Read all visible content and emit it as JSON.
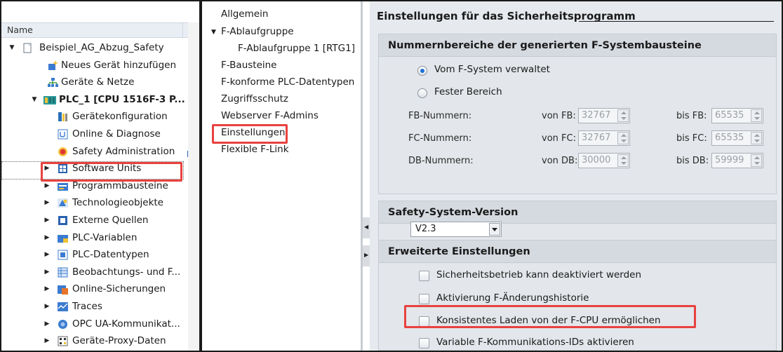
{
  "tree": {
    "header": "Name",
    "rows": [
      {
        "label": "Beispiel_AG_Abzug_Safety",
        "icon": "project-icon",
        "arrow": "open"
      },
      {
        "label": "Neues Gerät hinzufügen",
        "icon": "add-device-icon",
        "arrow": ""
      },
      {
        "label": "Geräte & Netze",
        "icon": "devices-networks-icon",
        "arrow": ""
      },
      {
        "label": "PLC_1 [CPU 1516F-3 P...",
        "icon": "plc-icon",
        "arrow": "open"
      },
      {
        "label": "Gerätekonfiguration",
        "icon": "device-config-icon",
        "arrow": ""
      },
      {
        "label": "Online & Diagnose",
        "icon": "online-diagnostics-icon",
        "arrow": ""
      },
      {
        "label": "Safety Administration",
        "icon": "safety-admin-icon",
        "arrow": ""
      },
      {
        "label": "Software Units",
        "icon": "software-units-icon",
        "arrow": "closed"
      },
      {
        "label": "Programmbausteine",
        "icon": "program-blocks-icon",
        "arrow": "closed"
      },
      {
        "label": "Technologieobjekte",
        "icon": "technology-objects-icon",
        "arrow": "closed"
      },
      {
        "label": "Externe Quellen",
        "icon": "external-sources-icon",
        "arrow": "closed"
      },
      {
        "label": "PLC-Variablen",
        "icon": "plc-tags-icon",
        "arrow": "closed"
      },
      {
        "label": "PLC-Datentypen",
        "icon": "plc-datatypes-icon",
        "arrow": "closed"
      },
      {
        "label": "Beobachtungs- und F...",
        "icon": "watch-tables-icon",
        "arrow": "closed"
      },
      {
        "label": "Online-Sicherungen",
        "icon": "online-backups-icon",
        "arrow": "closed"
      },
      {
        "label": "Traces",
        "icon": "traces-icon",
        "arrow": "closed"
      },
      {
        "label": "OPC UA-Kommunikat...",
        "icon": "opcua-icon",
        "arrow": "closed"
      },
      {
        "label": "Geräte-Proxy-Daten",
        "icon": "device-proxy-icon",
        "arrow": "closed"
      }
    ]
  },
  "nav": {
    "items": [
      {
        "label": "Allgemein"
      },
      {
        "label": "F-Ablaufgruppe"
      },
      {
        "label": "F-Ablaufgruppe 1 [RTG1]"
      },
      {
        "label": "F-Bausteine"
      },
      {
        "label": "F-konforme PLC-Datentypen"
      },
      {
        "label": "Zugriffsschutz"
      },
      {
        "label": "Webserver F-Admins"
      },
      {
        "label": "Einstellungen"
      },
      {
        "label": "Flexible F-Link"
      }
    ]
  },
  "panel": {
    "title": "Einstellungen für das Sicherheitsprogramm",
    "numbers": {
      "title": "Nummernbereiche der generierten F-Systembausteine",
      "radio_managed": "Vom F-System verwaltet",
      "radio_fixed": "Fester Bereich",
      "selected": "managed",
      "rows": [
        {
          "label": "FB-Nummern:",
          "from_label": "von FB:",
          "from_value": "32767",
          "to_label": "bis FB:",
          "to_value": "65535"
        },
        {
          "label": "FC-Nummern:",
          "from_label": "von FC:",
          "from_value": "32767",
          "to_label": "bis FC:",
          "to_value": "65535"
        },
        {
          "label": "DB-Nummern:",
          "from_label": "von DB:",
          "from_value": "30000",
          "to_label": "bis DB:",
          "to_value": "59999"
        }
      ]
    },
    "version": {
      "title": "Safety-System-Version",
      "value": "V2.3"
    },
    "advanced": {
      "title": "Erweiterte Einstellungen",
      "options": [
        {
          "label": "Sicherheitsbetrieb kann deaktiviert werden",
          "checked": false
        },
        {
          "label": "Aktivierung F-Änderungshistorie",
          "checked": false
        },
        {
          "label": "Konsistentes Laden von der F-CPU ermöglichen",
          "checked": false
        },
        {
          "label": "Variable F-Kommunikations-IDs aktivieren",
          "checked": false
        }
      ]
    }
  },
  "colors": {
    "highlight": "#e8423f",
    "radio_selected": "#1f6fd8",
    "panel_bg": "#e6e9ee"
  }
}
